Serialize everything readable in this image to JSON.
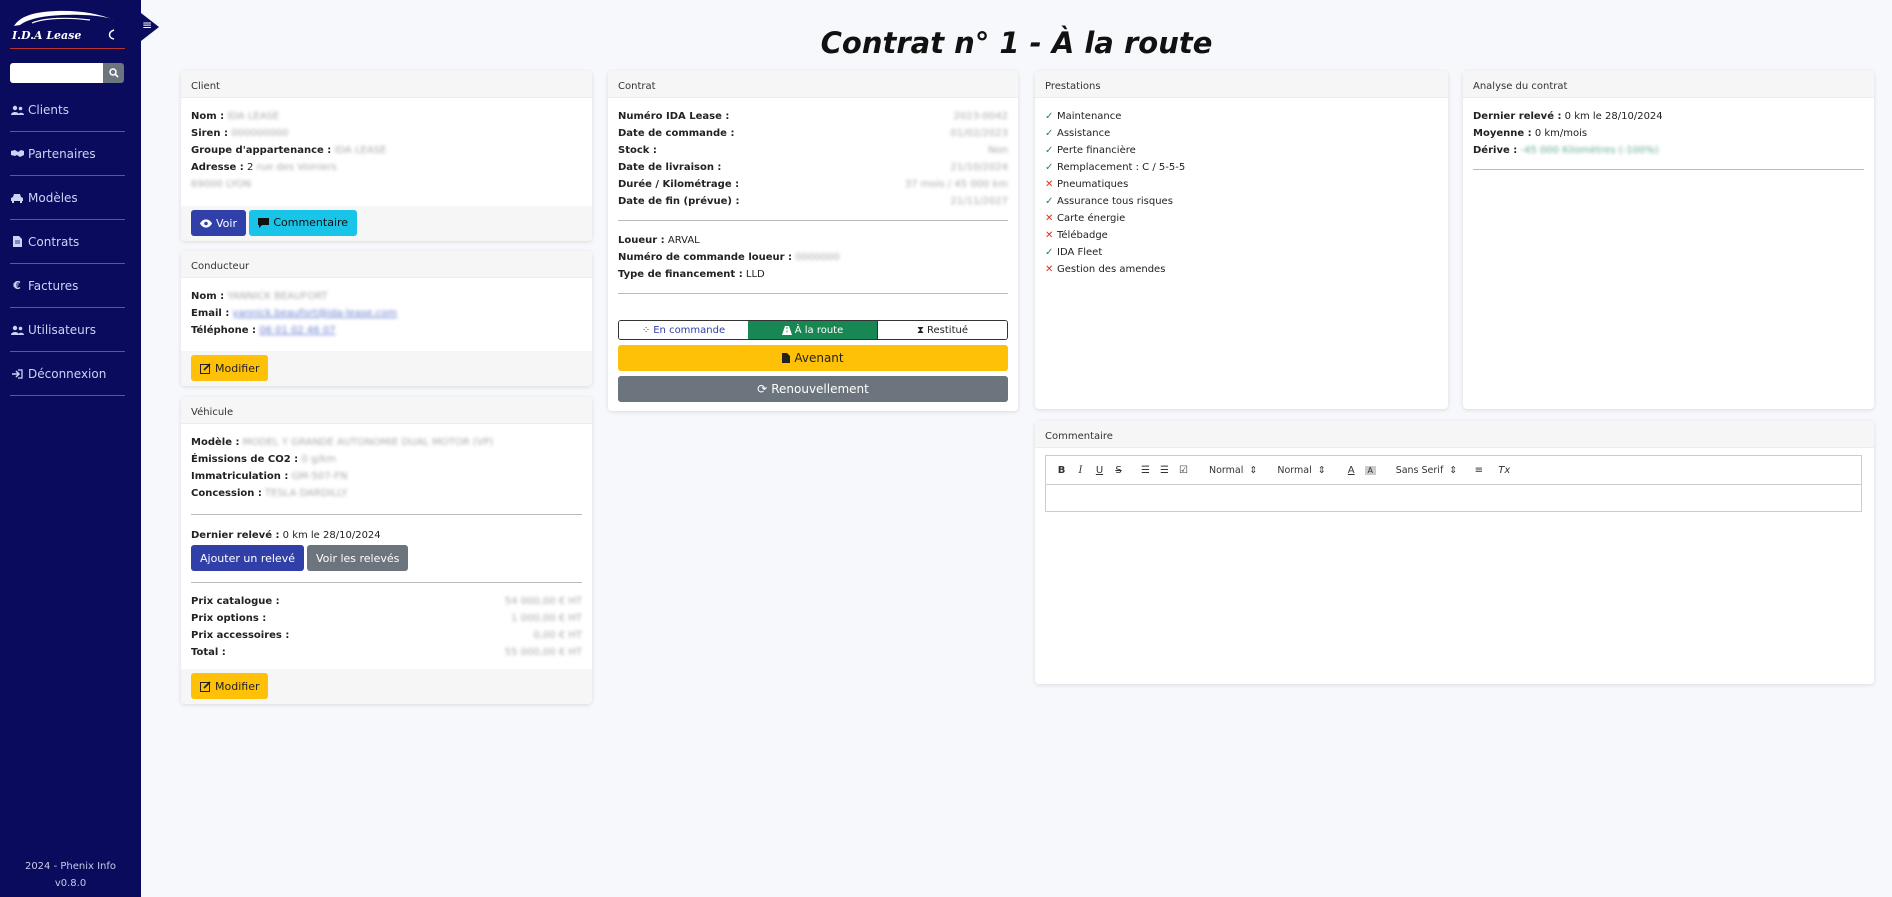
{
  "brand": {
    "logo_text": "I.D.A Lease",
    "menu_icon": "hamburger-icon"
  },
  "search": {
    "placeholder": "",
    "value": ""
  },
  "nav": [
    {
      "label": "Clients",
      "icon": "users-icon"
    },
    {
      "label": "Partenaires",
      "icon": "handshake-icon"
    },
    {
      "label": "Modèles",
      "icon": "car-icon"
    },
    {
      "label": "Contrats",
      "icon": "file-icon"
    },
    {
      "label": "Factures",
      "icon": "euro-icon"
    },
    {
      "label": "Utilisateurs",
      "icon": "user-group-icon"
    },
    {
      "label": "Déconnexion",
      "icon": "sign-out-icon"
    }
  ],
  "footer": {
    "copyright": "2024 - Phenix Info",
    "version": "v0.8.0"
  },
  "page": {
    "title": "Contrat n° 1 - À la route"
  },
  "client": {
    "header": "Client",
    "nom_label": "Nom :",
    "nom": "IDA LEASE",
    "siren_label": "Siren :",
    "siren": "000000000",
    "groupe_label": "Groupe d'appartenance :",
    "groupe": "IDA LEASE",
    "adresse_label": "Adresse :",
    "adresse_num": "2",
    "adresse_rue": "rue des Voiniers",
    "adresse_ville": "69000 LYON",
    "voir": "Voir",
    "commentaire": "Commentaire"
  },
  "conducteur": {
    "header": "Conducteur",
    "nom_label": "Nom :",
    "nom": "YANNICK BEAUFORT",
    "email_label": "Email :",
    "email": "yannick.beaufort@ida-lease.com",
    "tel_label": "Téléphone :",
    "tel": "06 01 02 46 07",
    "modifier": "Modifier"
  },
  "vehicule": {
    "header": "Véhicule",
    "modele_label": "Modèle :",
    "modele": "MODEL Y GRANDE AUTONOMIE DUAL MOTOR (VP)",
    "co2_label": "Émissions de CO2 :",
    "co2": "0 g/km",
    "immat_label": "Immatriculation :",
    "immat": "GM-507-FN",
    "concession_label": "Concession :",
    "concession": "TESLA DARDILLY",
    "releve_label": "Dernier relevé :",
    "releve": "0 km le 28/10/2024",
    "ajouter": "Ajouter un relevé",
    "voir_releves": "Voir les relevés",
    "prix_catalogue_label": "Prix catalogue :",
    "prix_catalogue": "54 000,00 € HT",
    "prix_options_label": "Prix options :",
    "prix_options": "1 000,00 € HT",
    "prix_accessoires_label": "Prix accessoires :",
    "prix_accessoires": "0,00 € HT",
    "total_label": "Total :",
    "total": "55 000,00 € HT",
    "modifier": "Modifier"
  },
  "contrat": {
    "header": "Contrat",
    "numero_label": "Numéro IDA Lease :",
    "numero": "2023-0042",
    "date_commande_label": "Date de commande :",
    "date_commande": "01/02/2023",
    "stock_label": "Stock :",
    "stock": "Non",
    "date_livraison_label": "Date de livraison :",
    "date_livraison": "21/10/2024",
    "duree_label": "Durée / Kilométrage :",
    "duree": "37 mois / 45 000 km",
    "date_fin_label": "Date de fin (prévue) :",
    "date_fin": "21/11/2027",
    "loueur_label": "Loueur :",
    "loueur": "ARVAL",
    "num_cmd_label": "Numéro de commande loueur :",
    "num_cmd": "0000000",
    "financement_label": "Type de financement :",
    "financement": "LLD",
    "status_en_commande": "En commande",
    "status_a_la_route": "À la route",
    "status_restitue": "Restitué",
    "avenant": "Avenant",
    "renouvellement": "Renouvellement"
  },
  "prestations": {
    "header": "Prestations",
    "items": [
      {
        "label": "Maintenance",
        "included": true
      },
      {
        "label": "Assistance",
        "included": true
      },
      {
        "label": "Perte financière",
        "included": true
      },
      {
        "label": "Remplacement : C / 5-5-5",
        "included": true
      },
      {
        "label": "Pneumatiques",
        "included": false
      },
      {
        "label": "Assurance tous risques",
        "included": true
      },
      {
        "label": "Carte énergie",
        "included": false
      },
      {
        "label": "Télébadge",
        "included": false
      },
      {
        "label": "IDA Fleet",
        "included": true
      },
      {
        "label": "Gestion des amendes",
        "included": false
      }
    ]
  },
  "analyse": {
    "header": "Analyse du contrat",
    "releve_label": "Dernier relevé :",
    "releve": "0 km le 28/10/2024",
    "moyenne_label": "Moyenne :",
    "moyenne": "0 km/mois",
    "derive_label": "Dérive :",
    "derive": "-45 000 Kilomètres (-100%)"
  },
  "commentaire": {
    "header": "Commentaire",
    "toolbar": {
      "size1": "Normal",
      "size2": "Normal",
      "font": "Sans Serif"
    },
    "content": ""
  }
}
